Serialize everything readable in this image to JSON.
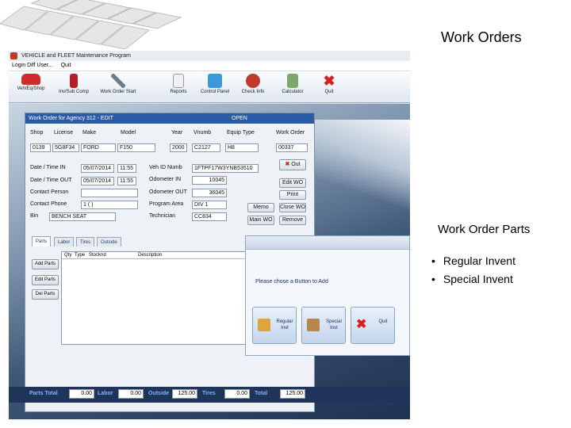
{
  "slide": {
    "title": "Work Orders",
    "subtitle": "Work Order Parts",
    "bullets": [
      "Regular Invent",
      "Special  Invent"
    ]
  },
  "app": {
    "title": "VEHICLE and FLEET Maintenance Program",
    "menu": [
      "Login Diff User...",
      "Quit"
    ],
    "toolbar": [
      "Veh/Eq/Shop",
      "Inv/Sub Comp",
      "Work Order Start",
      "Reports",
      "Control Panel",
      "Check Info",
      "Calculator",
      "Quit"
    ]
  },
  "form": {
    "title": "Work Order for Agency 312 - EDIT",
    "status": "OPEN",
    "headers": [
      "Shop",
      "License",
      "Make",
      "Model",
      "Year",
      "Vnumb",
      "Equip Type",
      "Work Order"
    ],
    "values": [
      "0139",
      "5G8F34",
      "FORD",
      "F150",
      "2000",
      "C2127",
      "H8",
      "00337"
    ],
    "labels": {
      "date_in": "Date / Time IN",
      "date_out": "Date / Time OUT",
      "contact_person": "Contact Person",
      "contact_phone": "Contact Phone",
      "bin": "Bin",
      "veh_id": "Veh ID Numb",
      "odo_in": "Odometer IN",
      "odo_out": "Odometer OUT",
      "program_area": "Program Area",
      "technician": "Technician"
    },
    "date_in": "05/07/2014",
    "time_in": "11:55",
    "date_out": "05/07/2014",
    "time_out": "11:55",
    "contact_phone": "1 (  )",
    "bin": "BENCH SEAT",
    "veh_id": "1FTPF17W3YNB53510",
    "odo_in": "10045",
    "odo_out": "36045",
    "program_area": "DIV 1",
    "technician": "CC834",
    "buttons": {
      "out": "Out",
      "edit": "Edit WO",
      "print": "Print",
      "memo": "Memo",
      "close": "Close WO",
      "main": "Main WO",
      "remove": "Remove"
    },
    "tabs": [
      "Parts",
      "Labor",
      "Tires",
      "Outside"
    ],
    "grid_headers": [
      "Qty",
      "Type",
      "Stocknd",
      "Description"
    ],
    "side_buttons": [
      "Add Parts",
      "Edit Parts",
      "Del Parts"
    ]
  },
  "totals": {
    "parts_label": "Parts Total",
    "parts": "0.00",
    "labor_label": "Labor",
    "labor": "0.00",
    "outside_label": "Outside",
    "outside": "125.00",
    "tires_label": "Tires",
    "tires": "0.00",
    "total_label": "Total",
    "total": "125.00"
  },
  "dialog": {
    "message": "Please chose a Button to Add",
    "buttons": [
      "Regular Invt",
      "Special Invt",
      "Quit"
    ]
  },
  "colors": {
    "accent": "#2b5aa8",
    "totals_bar": "#1f3458",
    "dialog_text": "#1c2f6b"
  }
}
